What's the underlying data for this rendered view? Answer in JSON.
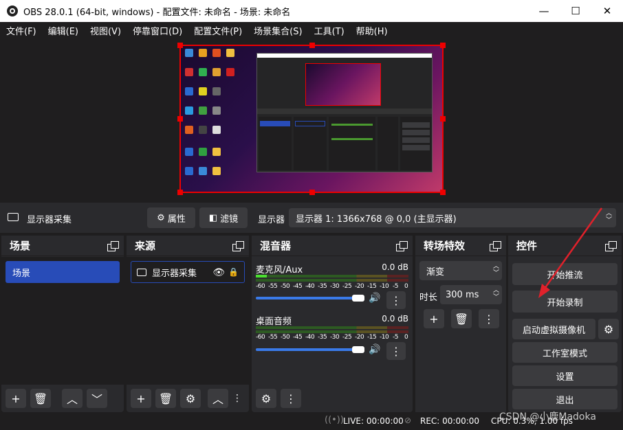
{
  "window": {
    "title": "OBS 28.0.1 (64-bit, windows) - 配置文件: 未命名 - 场景: 未命名",
    "minimize": "—",
    "maximize": "☐",
    "close": "✕"
  },
  "menu": [
    "文件(F)",
    "编辑(E)",
    "视图(V)",
    "停靠窗口(D)",
    "配置文件(P)",
    "场景集合(S)",
    "工具(T)",
    "帮助(H)"
  ],
  "props": {
    "source_name": "显示器采集",
    "properties": "属性",
    "filters": "滤镜",
    "display_label": "显示器",
    "display_value": "显示器 1: 1366x768 @ 0,0 (主显示器)"
  },
  "scenes": {
    "title": "场景",
    "items": [
      "场景"
    ]
  },
  "sources": {
    "title": "来源",
    "items": [
      "显示器采集"
    ]
  },
  "mixer": {
    "title": "混音器",
    "channels": [
      {
        "name": "麦克风/Aux",
        "db": "0.0 dB",
        "level": 0.07
      },
      {
        "name": "桌面音频",
        "db": "0.0 dB",
        "level": 0
      }
    ],
    "ticks": [
      "-60",
      "-55",
      "-50",
      "-45",
      "-40",
      "-35",
      "-30",
      "-25",
      "-20",
      "-15",
      "-10",
      "-5",
      "0"
    ]
  },
  "transitions": {
    "title": "转场特效",
    "type": "渐变",
    "duration_label": "时长",
    "duration_value": "300 ms"
  },
  "controls": {
    "title": "控件",
    "start_stream": "开始推流",
    "start_record": "开始录制",
    "virtual_cam": "启动虚拟摄像机",
    "studio_mode": "工作室模式",
    "settings": "设置",
    "exit": "退出"
  },
  "status": {
    "live": "LIVE: 00:00:00",
    "rec": "REC: 00:00:00",
    "cpu": "CPU: 0.3%, 1.00 fps",
    "watermark": "CSDN @小鹿Madoka"
  },
  "colors": {
    "accent": "#284cb8",
    "arrow": "#e0212b",
    "selection": "#e00000",
    "meter_green": "#4a9a2f",
    "meter_yellow": "#9a8a1f",
    "meter_red": "#8a2f2f"
  }
}
